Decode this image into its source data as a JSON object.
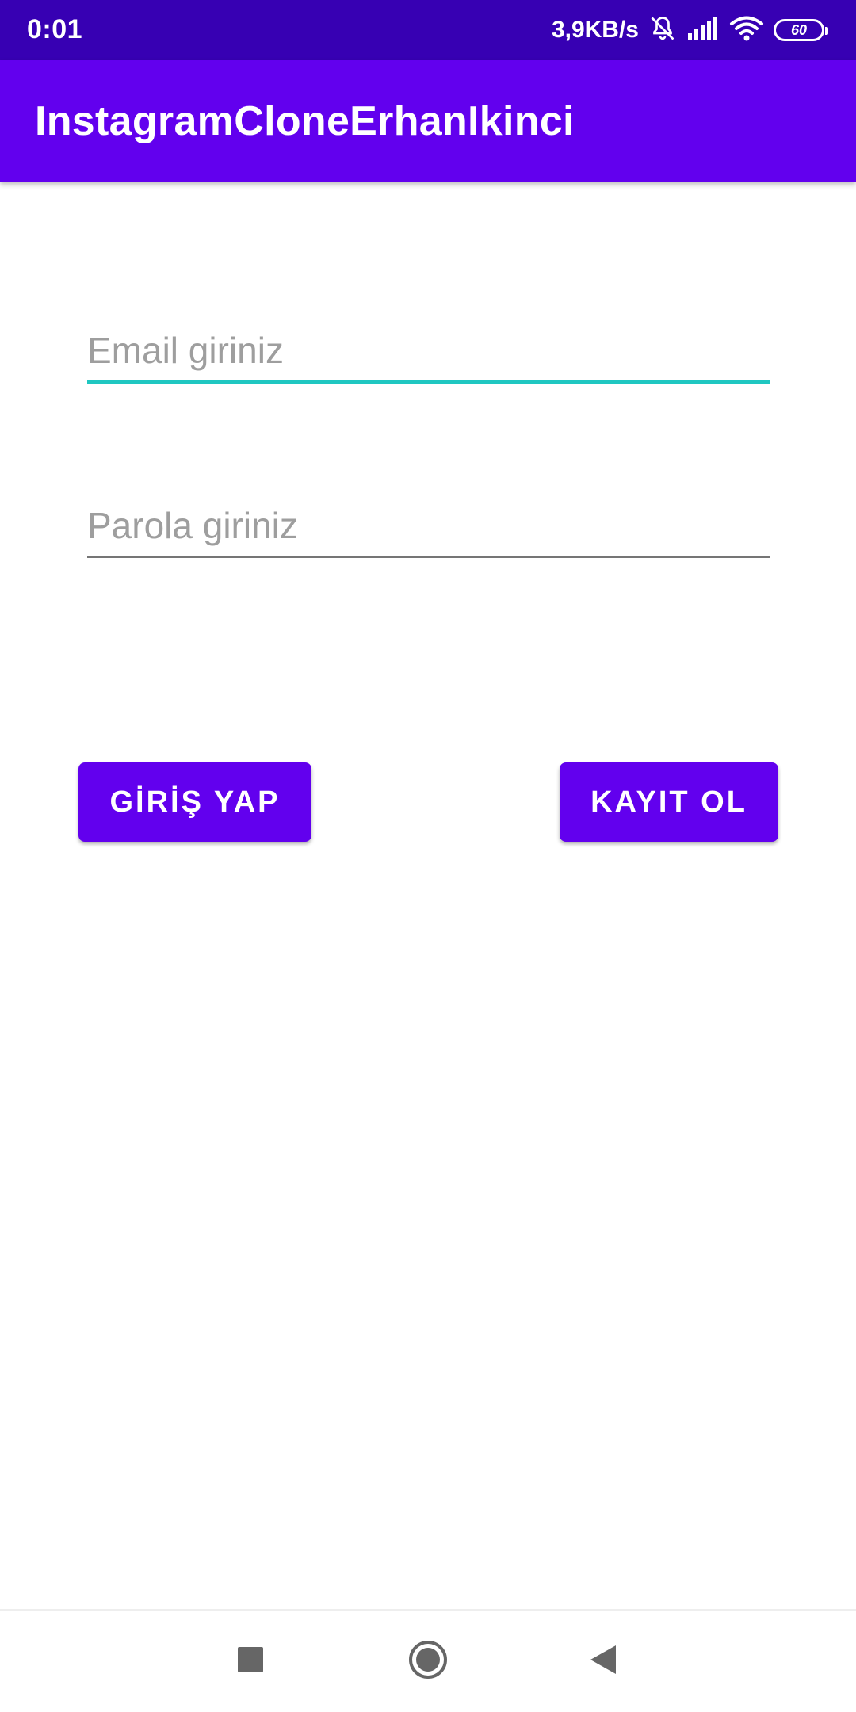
{
  "status_bar": {
    "time": "0:01",
    "network_speed": "3,9KB/s",
    "battery_level": "60",
    "icons": [
      "bell-off-icon",
      "signal-icon",
      "wifi-icon",
      "battery-icon"
    ]
  },
  "app_bar": {
    "title": "InstagramCloneErhanIkinci",
    "color": "#6200ee"
  },
  "form": {
    "email": {
      "value": "",
      "placeholder": "Email giriniz",
      "focused": true,
      "accent_color": "#1fc7c1"
    },
    "password": {
      "value": "",
      "placeholder": "Parola giriniz"
    }
  },
  "buttons": {
    "login_label": "GİRİŞ YAP",
    "register_label": "KAYIT OL"
  },
  "nav_bar": {
    "icons": [
      "recents-square-icon",
      "home-circle-icon",
      "back-triangle-icon"
    ]
  },
  "colors": {
    "status_bar": "#3700b3",
    "primary": "#6200ee"
  }
}
